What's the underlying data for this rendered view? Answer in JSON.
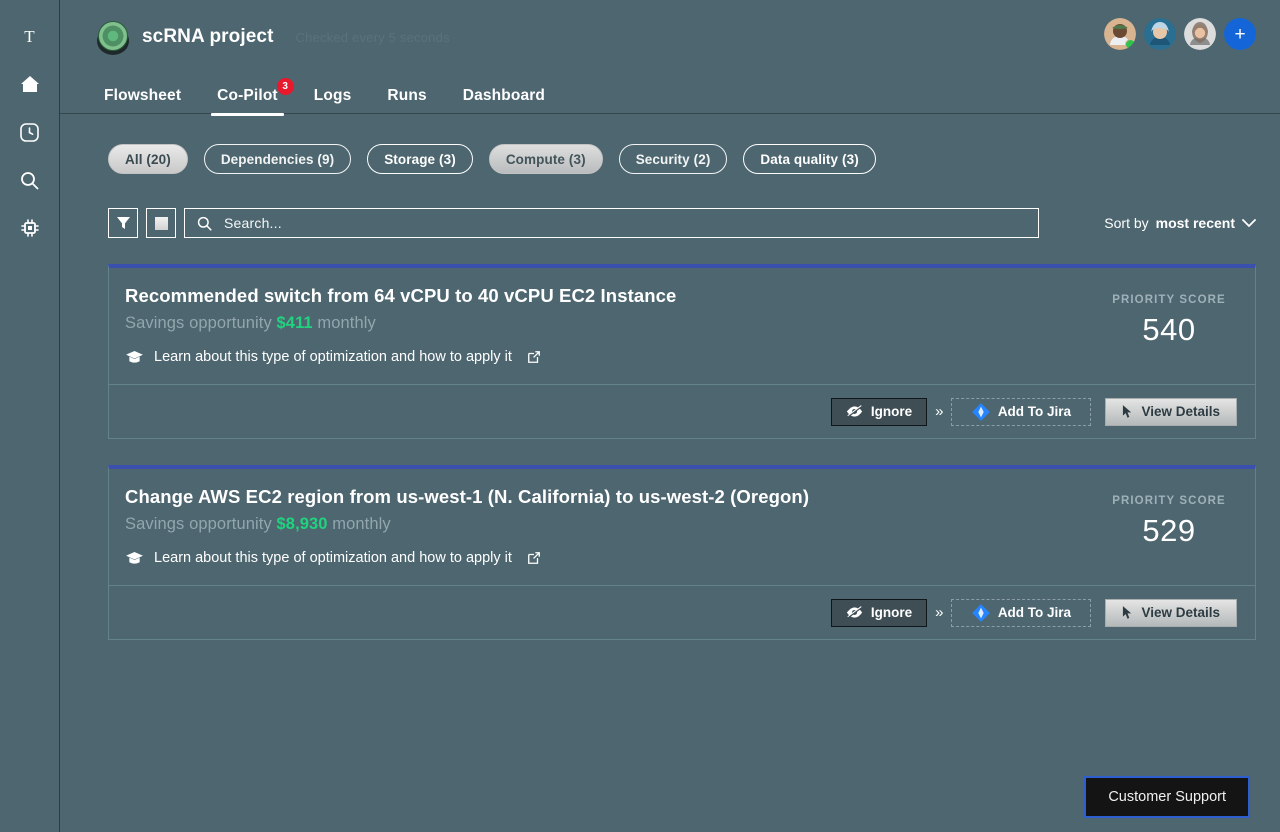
{
  "sidebar": {
    "items": [
      {
        "name": "logo-t",
        "icon": "letter-t-icon"
      },
      {
        "name": "home",
        "icon": "home-icon"
      },
      {
        "name": "history",
        "icon": "history-clock-icon"
      },
      {
        "name": "search",
        "icon": "search-icon"
      },
      {
        "name": "compute",
        "icon": "chip-icon"
      }
    ]
  },
  "header": {
    "project_title": "scRNA project",
    "checked_note": "Checked every 5 seconds",
    "add_member_label": "+",
    "tabs": [
      {
        "label": "Flowsheet",
        "active": false,
        "badge": ""
      },
      {
        "label": "Co-Pilot",
        "active": true,
        "badge": "3"
      },
      {
        "label": "Logs",
        "active": false,
        "badge": ""
      },
      {
        "label": "Runs",
        "active": false,
        "badge": ""
      },
      {
        "label": "Dashboard",
        "active": false,
        "badge": ""
      }
    ]
  },
  "filters": {
    "chips": [
      {
        "label": "All (20)",
        "state": "selected"
      },
      {
        "label": "Dependencies (9)",
        "state": "outline"
      },
      {
        "label": "Storage (3)",
        "state": "outline"
      },
      {
        "label": "Compute (3)",
        "state": "soft"
      },
      {
        "label": "Security (2)",
        "state": "outline"
      },
      {
        "label": "Data quality (3)",
        "state": "outline"
      }
    ]
  },
  "toolbar": {
    "filter_icon": "funnel-icon",
    "view_icon": "square-icon",
    "search_placeholder": "Search...",
    "search_value": "",
    "sort_prefix": "Sort by",
    "sort_value": "most recent"
  },
  "recommendations": [
    {
      "title": "Recommended switch from 64 vCPU to 40 vCPU EC2 Instance",
      "savings_prefix": "Savings opportunity",
      "savings_amount": "$411",
      "savings_suffix": "monthly",
      "learn_text": "Learn about this type of optimization and how to apply it",
      "score_label": "PRIORITY SCORE",
      "score_value": "540",
      "ignore_label": "Ignore",
      "expand_label": "»",
      "jira_label": "Add To Jira",
      "details_label": "View Details"
    },
    {
      "title": "Change AWS EC2 region from us-west-1 (N. California) to us-west-2 (Oregon)",
      "savings_prefix": "Savings opportunity",
      "savings_amount": "$8,930",
      "savings_suffix": "monthly",
      "learn_text": "Learn about this type of optimization and how to apply it",
      "score_label": "PRIORITY SCORE",
      "score_value": "529",
      "ignore_label": "Ignore",
      "expand_label": "»",
      "jira_label": "Add To Jira",
      "details_label": "View Details"
    }
  ],
  "support": {
    "label": "Customer Support"
  },
  "colors": {
    "background": "#4d666f",
    "card_accent": "#3a4fae",
    "savings_green": "#20d37f",
    "badge_red": "#e8192c",
    "add_blue": "#1466d8",
    "support_border": "#2d5fd0"
  }
}
